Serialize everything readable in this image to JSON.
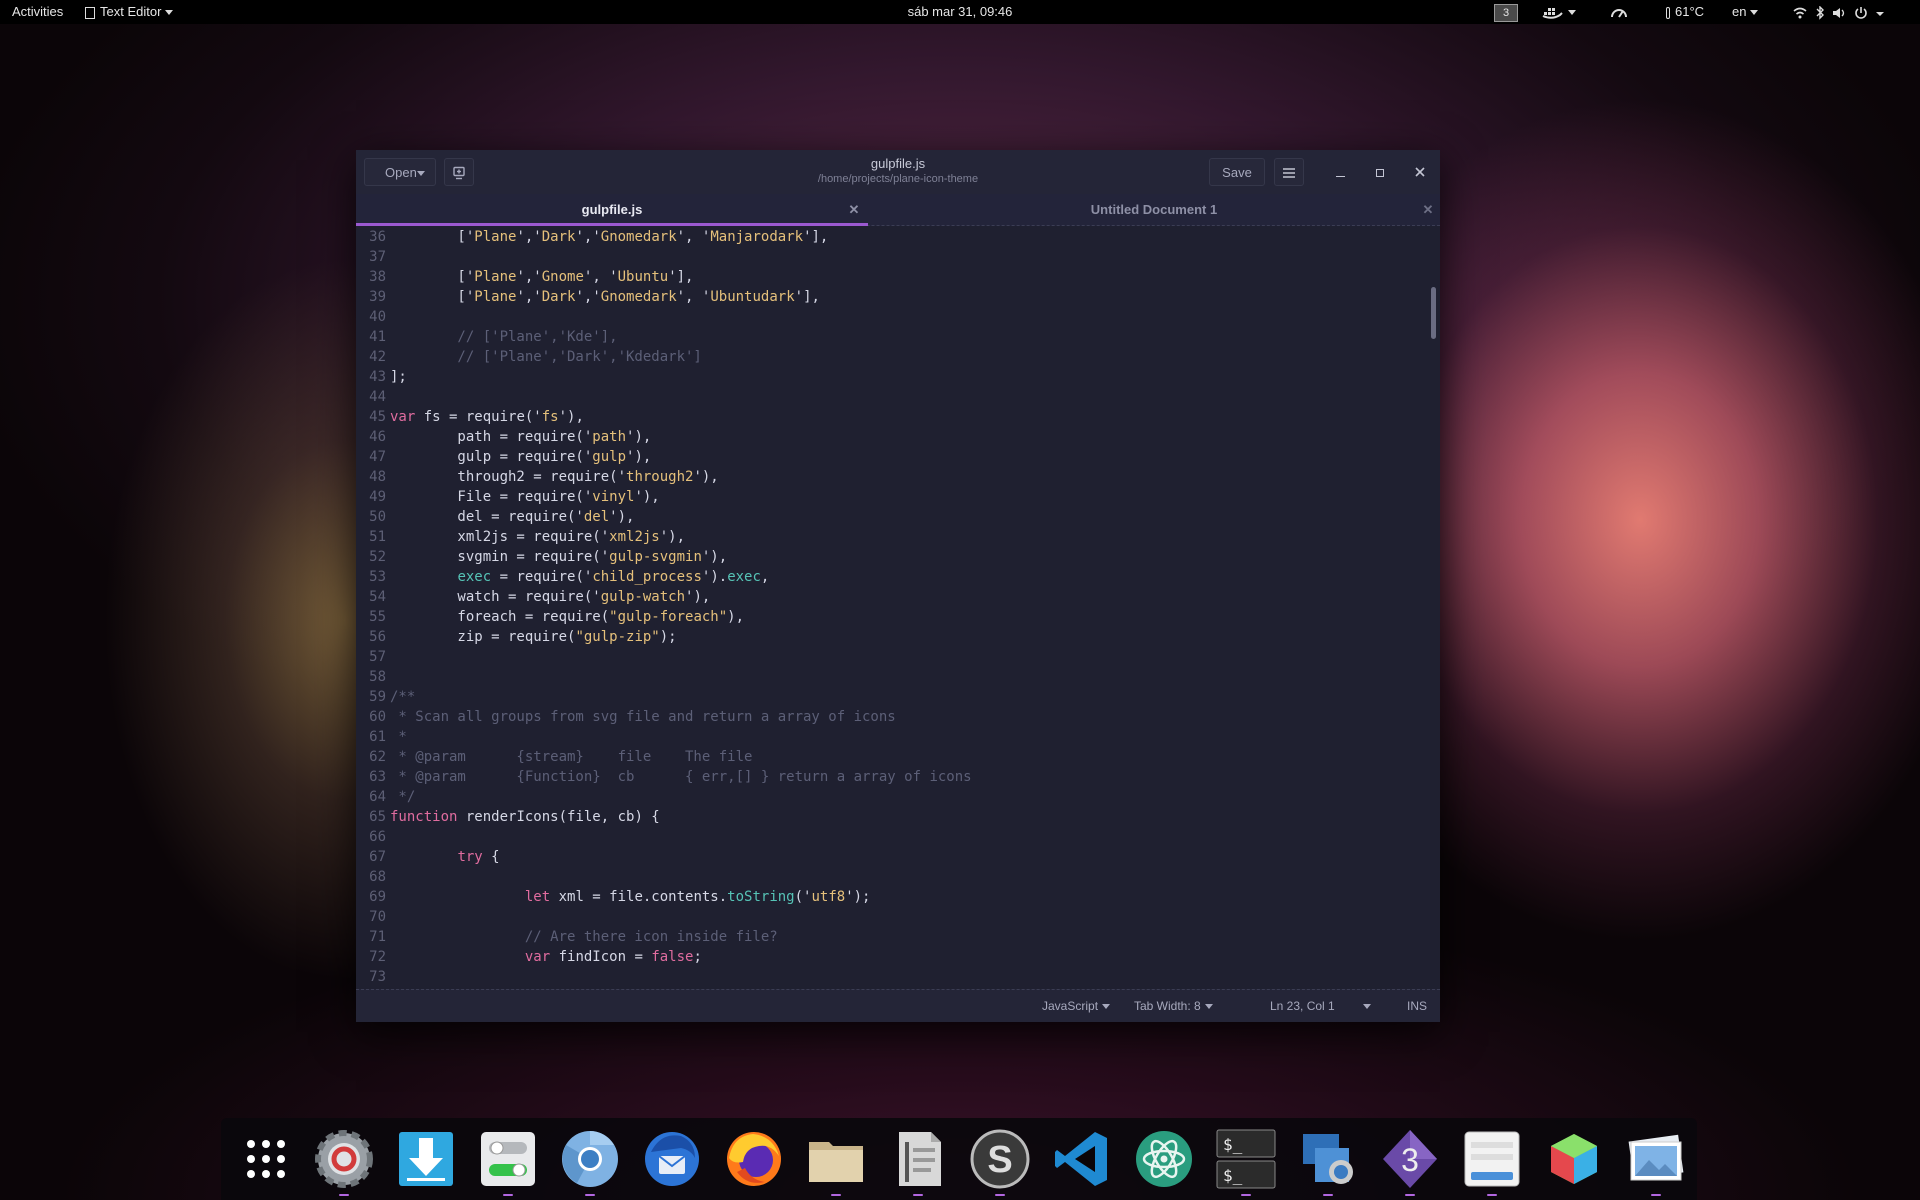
{
  "topbar": {
    "activities": "Activities",
    "app_menu": "Text Editor",
    "clock": "sáb mar 31, 09:46",
    "workspace": "3",
    "temperature": "61°C",
    "keyboard_layout": "en"
  },
  "window": {
    "open_label": "Open",
    "title": "gulpfile.js",
    "subtitle": "/home/projects/plane-icon-theme",
    "save_label": "Save",
    "tabs": [
      {
        "label": "gulpfile.js",
        "active": true
      },
      {
        "label": "Untitled Document 1",
        "active": false
      }
    ]
  },
  "editor": {
    "lines": [
      {
        "n": "36",
        "tokens": [
          [
            "t",
            "        ['"
          ],
          [
            "s",
            "Plane"
          ],
          [
            "t",
            "','"
          ],
          [
            "s",
            "Dark"
          ],
          [
            "t",
            "','"
          ],
          [
            "s",
            "Gnomedark"
          ],
          [
            "t",
            "', '"
          ],
          [
            "s",
            "Manjarodark"
          ],
          [
            "t",
            "'],"
          ]
        ]
      },
      {
        "n": "37",
        "tokens": []
      },
      {
        "n": "38",
        "tokens": [
          [
            "t",
            "        ['"
          ],
          [
            "s",
            "Plane"
          ],
          [
            "t",
            "','"
          ],
          [
            "s",
            "Gnome"
          ],
          [
            "t",
            "', '"
          ],
          [
            "s",
            "Ubuntu"
          ],
          [
            "t",
            "'],"
          ]
        ]
      },
      {
        "n": "39",
        "tokens": [
          [
            "t",
            "        ['"
          ],
          [
            "s",
            "Plane"
          ],
          [
            "t",
            "','"
          ],
          [
            "s",
            "Dark"
          ],
          [
            "t",
            "','"
          ],
          [
            "s",
            "Gnomedark"
          ],
          [
            "t",
            "', '"
          ],
          [
            "s",
            "Ubuntudark"
          ],
          [
            "t",
            "'],"
          ]
        ]
      },
      {
        "n": "40",
        "tokens": []
      },
      {
        "n": "41",
        "tokens": [
          [
            "c",
            "        // ['Plane','Kde'],"
          ]
        ]
      },
      {
        "n": "42",
        "tokens": [
          [
            "c",
            "        // ['Plane','Dark','Kdedark']"
          ]
        ]
      },
      {
        "n": "43",
        "tokens": [
          [
            "t",
            "];"
          ]
        ]
      },
      {
        "n": "44",
        "tokens": []
      },
      {
        "n": "45",
        "tokens": [
          [
            "k",
            "var"
          ],
          [
            "t",
            " fs = require('"
          ],
          [
            "s",
            "fs"
          ],
          [
            "t",
            "'),"
          ]
        ]
      },
      {
        "n": "46",
        "tokens": [
          [
            "t",
            "        path = require('"
          ],
          [
            "s",
            "path"
          ],
          [
            "t",
            "'),"
          ]
        ]
      },
      {
        "n": "47",
        "tokens": [
          [
            "t",
            "        gulp = require('"
          ],
          [
            "s",
            "gulp"
          ],
          [
            "t",
            "'),"
          ]
        ]
      },
      {
        "n": "48",
        "tokens": [
          [
            "t",
            "        through2 = require('"
          ],
          [
            "s",
            "through2"
          ],
          [
            "t",
            "'),"
          ]
        ]
      },
      {
        "n": "49",
        "tokens": [
          [
            "t",
            "        File = require('"
          ],
          [
            "s",
            "vinyl"
          ],
          [
            "t",
            "'),"
          ]
        ]
      },
      {
        "n": "50",
        "tokens": [
          [
            "t",
            "        del = require('"
          ],
          [
            "s",
            "del"
          ],
          [
            "t",
            "'),"
          ]
        ]
      },
      {
        "n": "51",
        "tokens": [
          [
            "t",
            "        xml2js = require('"
          ],
          [
            "s",
            "xml2js"
          ],
          [
            "t",
            "'),"
          ]
        ]
      },
      {
        "n": "52",
        "tokens": [
          [
            "t",
            "        svgmin = require('"
          ],
          [
            "s",
            "gulp-svgmin"
          ],
          [
            "t",
            "'),"
          ]
        ]
      },
      {
        "n": "53",
        "tokens": [
          [
            "t",
            "        "
          ],
          [
            "f",
            "exec"
          ],
          [
            "t",
            " = require('"
          ],
          [
            "s",
            "child_process"
          ],
          [
            "t",
            "')."
          ],
          [
            "f",
            "exec"
          ],
          [
            "t",
            ","
          ]
        ]
      },
      {
        "n": "54",
        "tokens": [
          [
            "t",
            "        watch = require('"
          ],
          [
            "s",
            "gulp-watch"
          ],
          [
            "t",
            "'),"
          ]
        ]
      },
      {
        "n": "55",
        "tokens": [
          [
            "t",
            "        foreach = require("
          ],
          [
            "s",
            "\"gulp-foreach\""
          ],
          [
            "t",
            "),"
          ]
        ]
      },
      {
        "n": "56",
        "tokens": [
          [
            "t",
            "        zip = require("
          ],
          [
            "s",
            "\"gulp-zip\""
          ],
          [
            "t",
            ");"
          ]
        ]
      },
      {
        "n": "57",
        "tokens": []
      },
      {
        "n": "58",
        "tokens": []
      },
      {
        "n": "59",
        "tokens": [
          [
            "c",
            "/**"
          ]
        ]
      },
      {
        "n": "60",
        "tokens": [
          [
            "c",
            " * Scan all groups from svg file and return a array of icons"
          ]
        ]
      },
      {
        "n": "61",
        "tokens": [
          [
            "c",
            " *"
          ]
        ]
      },
      {
        "n": "62",
        "tokens": [
          [
            "c",
            " * @param      {stream}    file    The file"
          ]
        ]
      },
      {
        "n": "63",
        "tokens": [
          [
            "c",
            " * @param      {Function}  cb      { err,[] } return a array of icons"
          ]
        ]
      },
      {
        "n": "64",
        "tokens": [
          [
            "c",
            " */"
          ]
        ]
      },
      {
        "n": "65",
        "tokens": [
          [
            "k",
            "function"
          ],
          [
            "t",
            " renderIcons(file, cb) {"
          ]
        ]
      },
      {
        "n": "66",
        "tokens": []
      },
      {
        "n": "67",
        "tokens": [
          [
            "t",
            "        "
          ],
          [
            "k",
            "try"
          ],
          [
            "t",
            " {"
          ]
        ]
      },
      {
        "n": "68",
        "tokens": []
      },
      {
        "n": "69",
        "tokens": [
          [
            "t",
            "                "
          ],
          [
            "k",
            "let"
          ],
          [
            "t",
            " xml = file.contents."
          ],
          [
            "f",
            "toString"
          ],
          [
            "t",
            "('"
          ],
          [
            "s",
            "utf8"
          ],
          [
            "t",
            "');"
          ]
        ]
      },
      {
        "n": "70",
        "tokens": []
      },
      {
        "n": "71",
        "tokens": [
          [
            "c",
            "                // Are there icon inside file?"
          ]
        ]
      },
      {
        "n": "72",
        "tokens": [
          [
            "t",
            "                "
          ],
          [
            "k",
            "var"
          ],
          [
            "t",
            " findIcon = "
          ],
          [
            "k",
            "false"
          ],
          [
            "t",
            ";"
          ]
        ]
      },
      {
        "n": "73",
        "tokens": []
      }
    ]
  },
  "statusbar": {
    "language": "JavaScript",
    "tab_width": "Tab Width: 8",
    "position": "Ln 23, Col 1",
    "mode": "INS"
  },
  "dock": {
    "apps": [
      "apps-grid-icon",
      "settings-icon",
      "downloader-icon",
      "tweaks-icon",
      "chromium-icon",
      "thunderbird-icon",
      "firefox-icon",
      "files-icon",
      "archive-icon",
      "sublime-icon",
      "vscode-icon",
      "atom-icon",
      "terminal-icon",
      "screenshot-icon",
      "blender-icon",
      "gtk-designer-icon",
      "cube-icon",
      "image-viewer-icon"
    ]
  },
  "colors": {
    "accent": "#9b59d0",
    "keyword": "#e06c9f",
    "string": "#e5c07b",
    "function": "#56c3b6",
    "comment": "#5c5f77"
  }
}
